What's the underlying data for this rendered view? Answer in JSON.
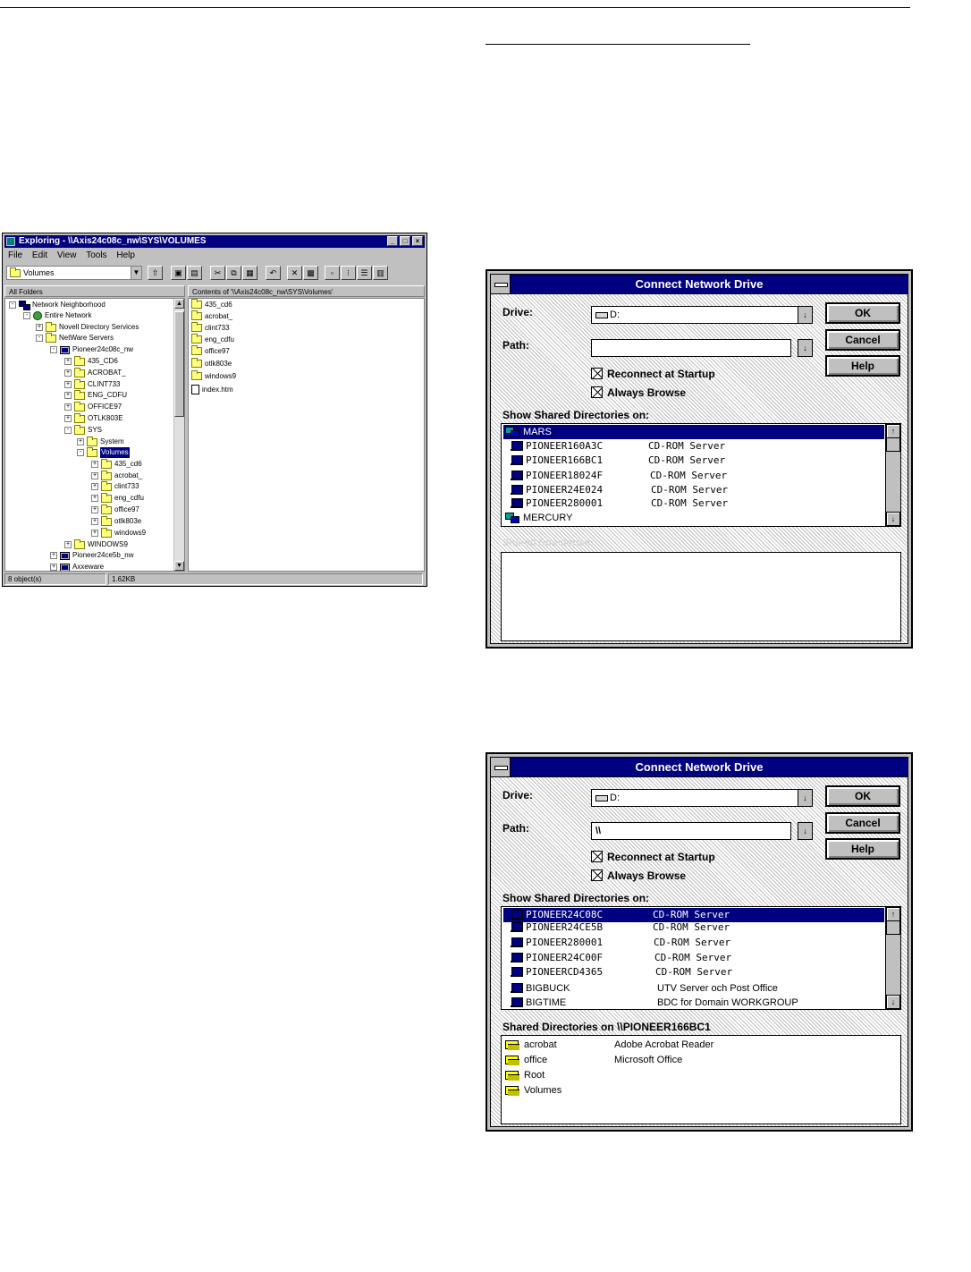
{
  "explorer": {
    "title": "Exploring - \\\\Axis24c08c_nw\\SYS\\VOLUMES",
    "menu": [
      "File",
      "Edit",
      "View",
      "Tools",
      "Help"
    ],
    "combo_value": "Volumes",
    "pane_left_header": "All Folders",
    "pane_right_header": "Contents of '\\\\Axis24c08c_nw\\SYS\\Volumes'",
    "tree": [
      {
        "label": "Network Neighborhood",
        "icon": "network-neighborhood-icon",
        "expander": "-"
      },
      {
        "label": "Entire Network",
        "icon": "globe-icon",
        "expander": "-"
      },
      {
        "label": "Novell Directory Services",
        "icon": "folder-icon",
        "expander": "+"
      },
      {
        "label": "NetWare Servers",
        "icon": "folder-icon",
        "expander": "-"
      },
      {
        "label": "Pioneer24c08c_nw",
        "icon": "server-icon",
        "expander": "-"
      },
      {
        "label": "435_CD6",
        "icon": "folder-icon",
        "expander": "+"
      },
      {
        "label": "ACROBAT_",
        "icon": "folder-icon",
        "expander": "+"
      },
      {
        "label": "CLINT733",
        "icon": "folder-icon",
        "expander": "+"
      },
      {
        "label": "ENG_CDFU",
        "icon": "folder-icon",
        "expander": "+"
      },
      {
        "label": "OFFICE97",
        "icon": "folder-icon",
        "expander": "+"
      },
      {
        "label": "OTLK803E",
        "icon": "folder-icon",
        "expander": "+"
      },
      {
        "label": "SYS",
        "icon": "folder-icon",
        "expander": "-"
      },
      {
        "label": "System",
        "icon": "folder-icon",
        "expander": "+"
      },
      {
        "label": "Volumes",
        "icon": "open-folder-icon",
        "expander": "-",
        "selected": true
      },
      {
        "label": "435_cd6",
        "icon": "folder-icon",
        "expander": "+"
      },
      {
        "label": "acrobat_",
        "icon": "folder-icon",
        "expander": "+"
      },
      {
        "label": "clint733",
        "icon": "folder-icon",
        "expander": "+"
      },
      {
        "label": "eng_cdfu",
        "icon": "folder-icon",
        "expander": "+"
      },
      {
        "label": "office97",
        "icon": "folder-icon",
        "expander": "+"
      },
      {
        "label": "otlk803e",
        "icon": "folder-icon",
        "expander": "+"
      },
      {
        "label": "windows9",
        "icon": "folder-icon",
        "expander": "+"
      },
      {
        "label": "WINDOWS9",
        "icon": "folder-icon",
        "expander": "+"
      },
      {
        "label": "Pioneer24ce5b_nw",
        "icon": "server-icon",
        "expander": "+"
      },
      {
        "label": "Axxeware",
        "icon": "server-icon",
        "expander": "+"
      }
    ],
    "contents": [
      {
        "label": "435_cd6",
        "icon": "folder-icon"
      },
      {
        "label": "acrobat_",
        "icon": "folder-icon"
      },
      {
        "label": "clint733",
        "icon": "folder-icon"
      },
      {
        "label": "eng_cdfu",
        "icon": "folder-icon"
      },
      {
        "label": "office97",
        "icon": "folder-icon"
      },
      {
        "label": "otlk803e",
        "icon": "folder-icon"
      },
      {
        "label": "windows9",
        "icon": "folder-icon"
      },
      {
        "label": "index.htm",
        "icon": "document-icon"
      }
    ],
    "status": {
      "objects": "8 object(s)",
      "size": "1.62KB"
    }
  },
  "dialog1": {
    "title": "Connect Network Drive",
    "drive_label": "Drive:",
    "drive_value": "D:",
    "path_label": "Path:",
    "path_value": "",
    "ok": "OK",
    "cancel": "Cancel",
    "help": "Help",
    "reconnect": "Reconnect at Startup",
    "always_browse": "Always Browse",
    "show_label": "Show Shared Directories on:",
    "servers": [
      {
        "name": "MARS",
        "desc": "",
        "icon": "network-icon",
        "selected": true
      },
      {
        "name": "PIONEER160A3C",
        "desc": "CD-ROM Server",
        "icon": "server-icon"
      },
      {
        "name": "PIONEER166BC1",
        "desc": "CD-ROM Server",
        "icon": "server-icon"
      },
      {
        "name": "PIONEER18024F",
        "desc": "CD-ROM Server",
        "icon": "server-icon"
      },
      {
        "name": "PIONEER24E024",
        "desc": "CD-ROM Server",
        "icon": "server-icon"
      },
      {
        "name": "PIONEER280001",
        "desc": "CD-ROM Server",
        "icon": "server-icon"
      },
      {
        "name": "MERCURY",
        "desc": "",
        "icon": "network-icon"
      }
    ],
    "shared_label": "Shared Directories:",
    "shared": []
  },
  "dialog2": {
    "title": "Connect Network Drive",
    "drive_label": "Drive:",
    "drive_value": "D:",
    "path_label": "Path:",
    "path_value": "\\\\",
    "ok": "OK",
    "cancel": "Cancel",
    "help": "Help",
    "reconnect": "Reconnect at Startup",
    "always_browse": "Always Browse",
    "show_label": "Show Shared Directories on:",
    "servers": [
      {
        "name": "PIONEER24C08C",
        "desc": "CD-ROM Server",
        "icon": "server-icon",
        "selected": true
      },
      {
        "name": "PIONEER24CE5B",
        "desc": "CD-ROM Server",
        "icon": "server-icon"
      },
      {
        "name": "PIONEER280001",
        "desc": "CD-ROM Server",
        "icon": "server-icon"
      },
      {
        "name": "PIONEER24C00F",
        "desc": "CD-ROM Server",
        "icon": "server-icon"
      },
      {
        "name": "PIONEERCD4365",
        "desc": "CD-ROM Server",
        "icon": "server-icon"
      },
      {
        "name": "BIGBUCK",
        "desc": "UTV Server och Post Office",
        "icon": "server-icon"
      },
      {
        "name": "BIGTIME",
        "desc": "BDC for Domain WORKGROUP",
        "icon": "server-icon"
      }
    ],
    "shared_label": "Shared Directories on  \\\\PIONEER166BC1",
    "shared": [
      {
        "name": "acrobat",
        "desc": "Adobe Acrobat Reader"
      },
      {
        "name": "office",
        "desc": "Microsoft Office"
      },
      {
        "name": "Root",
        "desc": ""
      },
      {
        "name": "Volumes",
        "desc": ""
      }
    ]
  }
}
